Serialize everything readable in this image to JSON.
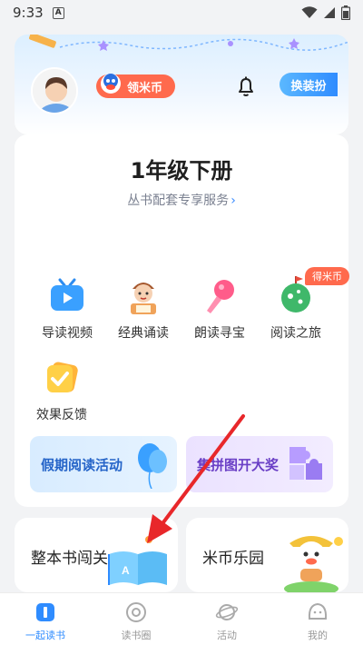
{
  "status_bar": {
    "time": "9:33",
    "notification": "A"
  },
  "header": {
    "coin_button": "领米币",
    "dress_button": "换装扮"
  },
  "book": {
    "title": "1年级下册",
    "subtitle": "丛书配套专享服务",
    "chevron": "›"
  },
  "features": [
    {
      "label": "导读视频",
      "icon": "tv-play-icon"
    },
    {
      "label": "经典诵读",
      "icon": "reading-kid-icon"
    },
    {
      "label": "朗读寻宝",
      "icon": "microphone-icon"
    },
    {
      "label": "阅读之旅",
      "icon": "map-flag-icon"
    },
    {
      "label": "效果反馈",
      "icon": "check-badge-icon"
    }
  ],
  "feature_badge": "得米币",
  "promos": {
    "holiday": "假期阅读活动",
    "puzzle": "集拼图开大奖"
  },
  "bottom_cards": {
    "left": "整本书闯关",
    "right": "米币乐园"
  },
  "tabs": [
    {
      "label": "一起读书",
      "icon": "book-icon",
      "active": true
    },
    {
      "label": "读书圈",
      "icon": "circle-icon",
      "active": false
    },
    {
      "label": "活动",
      "icon": "planet-icon",
      "active": false
    },
    {
      "label": "我的",
      "icon": "smiley-icon",
      "active": false
    }
  ],
  "colors": {
    "accent": "#2f8cff",
    "coin_orange": "#ff6a4d",
    "annotation_arrow": "#e8272a"
  }
}
